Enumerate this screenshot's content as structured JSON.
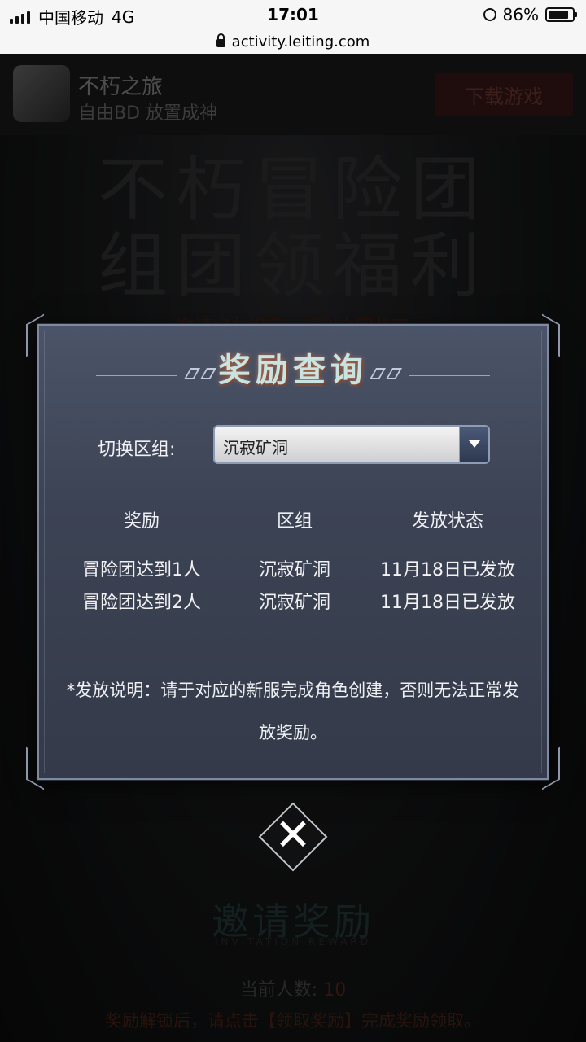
{
  "status_bar": {
    "carrier": "中国移动",
    "network": "4G",
    "time": "17:01",
    "battery_percent": "86%",
    "battery_level": 0.86
  },
  "url_bar": {
    "url": "activity.leiting.com"
  },
  "app_banner": {
    "app_name": "不朽之旅",
    "slogan": "自由BD 放置成神",
    "download_label": "下载游戏"
  },
  "background": {
    "title_line1": "不朽冒险团",
    "title_line2": "组团领福利",
    "subtitle": "邀请好友组团，福利全团共享",
    "section_title": "邀请奖励",
    "section_subtitle": "INVITATION REWARD",
    "count_label": "当前人数:",
    "count_value": "10",
    "note": "奖励解锁后，请点击【领取奖励】完成奖励领取。"
  },
  "modal": {
    "title": "奖励查询",
    "switch_label": "切换区组:",
    "selected_server": "沉寂矿洞",
    "columns": [
      "奖励",
      "区组",
      "发放状态"
    ],
    "rows": [
      {
        "reward": "冒险团达到1人",
        "server": "沉寂矿洞",
        "status": "11月18日已发放"
      },
      {
        "reward": "冒险团达到2人",
        "server": "沉寂矿洞",
        "status": "11月18日已发放"
      }
    ],
    "note": "*发放说明：请于对应的新服完成角色创建，否则无法正常发放奖励。"
  },
  "close_button": {
    "label": "✕"
  }
}
